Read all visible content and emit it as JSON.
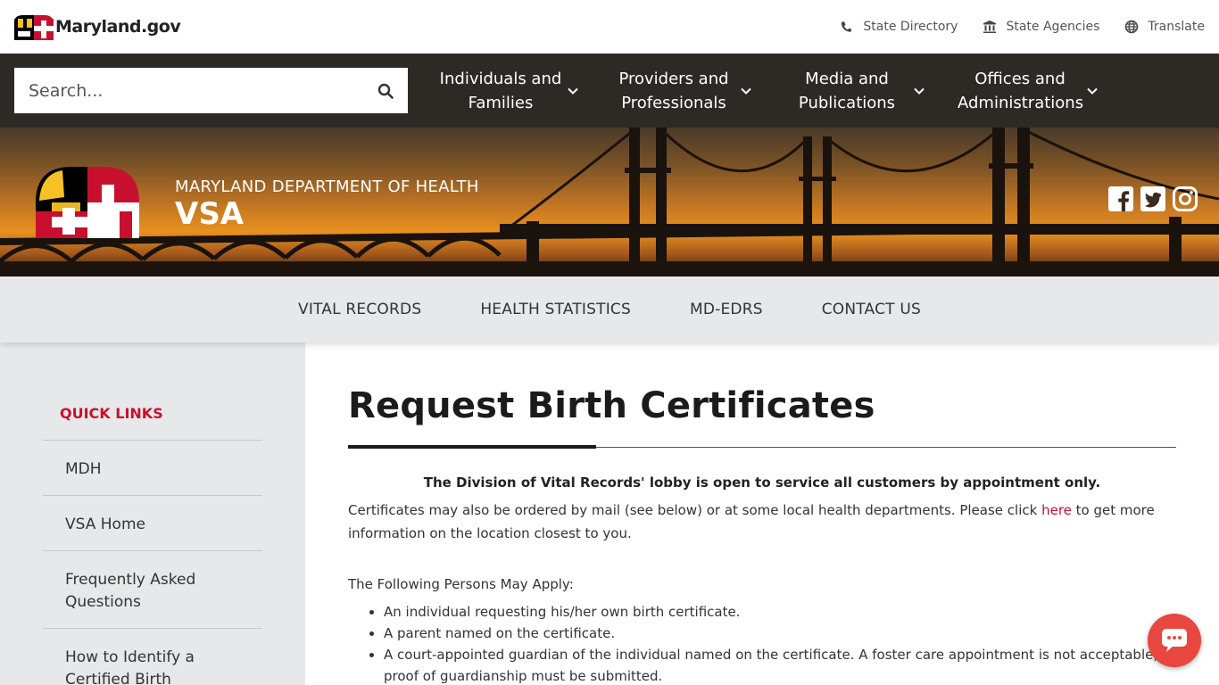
{
  "topbar": {
    "logo_text": "Maryland.gov",
    "links": [
      {
        "label": "State Directory",
        "icon": "phone-icon"
      },
      {
        "label": "State Agencies",
        "icon": "building-icon"
      },
      {
        "label": "Translate",
        "icon": "globe-icon"
      }
    ]
  },
  "navbar": {
    "search_placeholder": "Search...",
    "menu": [
      {
        "line1": "Individuals and",
        "line2": "Families"
      },
      {
        "line1": "Providers and",
        "line2": "Professionals"
      },
      {
        "line1": "Media and",
        "line2": "Publications"
      },
      {
        "line1": "Offices and",
        "line2": "Administrations"
      }
    ]
  },
  "hero": {
    "dept_name": "MARYLAND DEPARTMENT OF HEALTH",
    "dept_sub": "VSA",
    "social": [
      "facebook-icon",
      "twitter-icon",
      "instagram-icon"
    ]
  },
  "subnav": [
    "VITAL RECORDS",
    "HEALTH STATISTICS",
    "MD-EDRS",
    "CONTACT US"
  ],
  "sidebar": {
    "heading": "QUICK LINKS",
    "items": [
      "MDH",
      "VSA Home",
      "Frequently Asked Questions",
      "How to Identify a Certified Birth"
    ]
  },
  "main": {
    "title": "Request Birth Certificates",
    "notice": "The Division of Vital Records' lobby is open to service all customers by appointment only.",
    "para_before_link": "Certificates may also be ordered by mail (see below) or at some local health departments. Please click ",
    "para_link": "here",
    "para_after_link": " to get more information on the location closest to you.",
    "apply_heading": "The Following Persons May Apply:",
    "list": [
      "An individual requesting his/her own birth certificate.",
      "A parent named on the certificate.",
      "A court-appointed guardian of the individual named on the certificate. A foster care appointment is not acceptable; proof of guardianship must be submitted."
    ]
  },
  "colors": {
    "nav_bg": "#2d2a26",
    "accent_red": "#c8102e",
    "sidebar_bg": "#e6e8ea",
    "chat_button": "#e8473f"
  }
}
